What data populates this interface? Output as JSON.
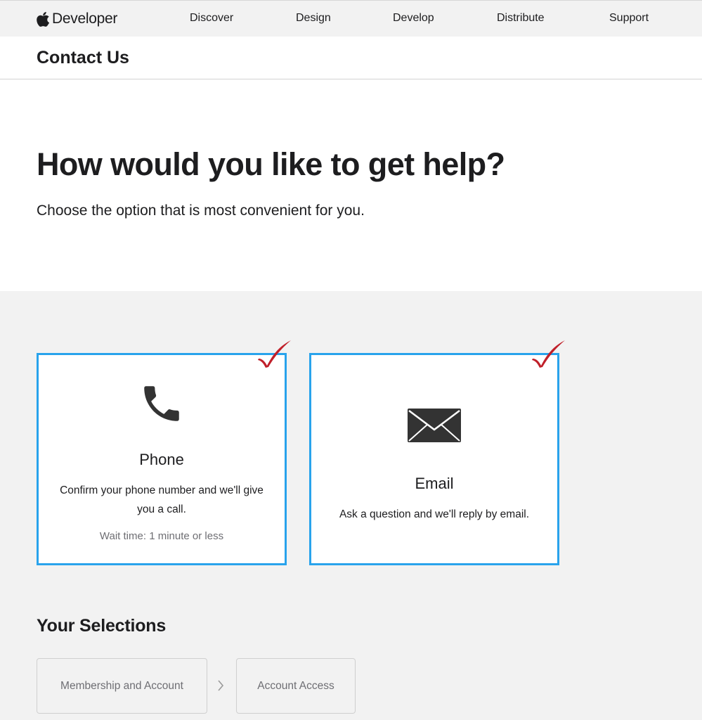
{
  "globalnav": {
    "brand": "Developer",
    "links": [
      "Discover",
      "Design",
      "Develop",
      "Distribute",
      "Support"
    ]
  },
  "localnav": {
    "title": "Contact Us"
  },
  "hero": {
    "title": "How would you like to get help?",
    "subtitle": "Choose the option that is most convenient for you."
  },
  "options": [
    {
      "title": "Phone",
      "description": "Confirm your phone number and we'll give you a call.",
      "wait": "Wait time: 1 minute or less",
      "icon": "phone-icon"
    },
    {
      "title": "Email",
      "description": "Ask a question and we'll reply by email.",
      "icon": "envelope-icon"
    }
  ],
  "selections": {
    "title": "Your Selections",
    "items": [
      "Membership and Account",
      "Account Access"
    ]
  },
  "colors": {
    "card_border": "#29a3ec",
    "check_mark": "#c0202a",
    "section_bg": "#f2f2f2"
  }
}
